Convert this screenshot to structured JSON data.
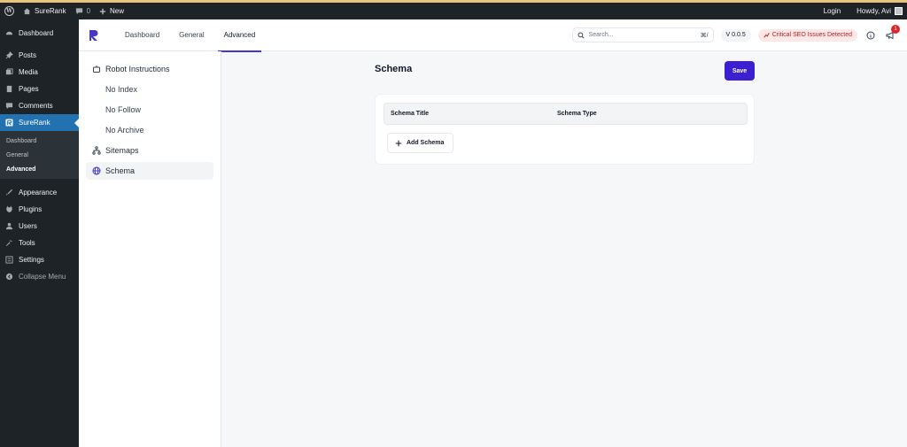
{
  "adminbar": {
    "site_name": "SureRank",
    "comments_count": "0",
    "new_label": "New",
    "login_label": "Login",
    "howdy": "Howdy, Avi"
  },
  "wp_menu": {
    "dashboard": "Dashboard",
    "posts": "Posts",
    "media": "Media",
    "pages": "Pages",
    "comments": "Comments",
    "surerank": "SureRank",
    "submenu": [
      "Dashboard",
      "General",
      "Advanced"
    ],
    "appearance": "Appearance",
    "plugins": "Plugins",
    "users": "Users",
    "tools": "Tools",
    "settings": "Settings",
    "collapse": "Collapse Menu"
  },
  "topnav": {
    "tabs": [
      "Dashboard",
      "General",
      "Advanced"
    ],
    "active_tab": "Advanced",
    "search_placeholder": "Search...",
    "search_shortcut": "⌘/",
    "version": "V 0.0.5",
    "critical_label": "Critical SEO Issues Detected",
    "notification_count": "1"
  },
  "settings_nav": {
    "robot_instructions": "Robot Instructions",
    "no_index": "No Index",
    "no_follow": "No Follow",
    "no_archive": "No Archive",
    "sitemaps": "Sitemaps",
    "schema": "Schema"
  },
  "main": {
    "title": "Schema",
    "save_label": "Save",
    "table_headers": [
      "Schema Title",
      "Schema Type"
    ],
    "add_schema_label": "Add Schema"
  },
  "colors": {
    "accent": "#3b1fd1",
    "wp_dark": "#1d2327",
    "wp_active": "#2271b1",
    "critical_bg": "#fde8e8",
    "critical_text": "#b91c1c"
  }
}
